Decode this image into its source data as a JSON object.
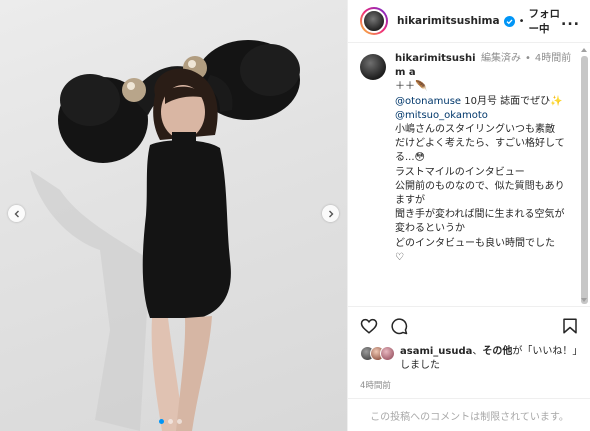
{
  "header": {
    "username": "hikarimitsushima",
    "separator": "•",
    "follow_status": "フォロー中",
    "more": "..."
  },
  "caption": {
    "username": "hikarimitsushim a",
    "edited": "編集済み",
    "dot": "•",
    "time": "4時間前",
    "lines": [
      "＋＋🪶",
      "",
      "",
      "10月号 誌面でぜひ✨",
      "",
      "",
      "小嶋さんのスタイリングいつも素敵",
      "だけどよく考えたら、すごい格好して",
      "る...😳",
      "",
      "ラストマイルのインタビュー",
      "公開前のものなので、似た質問もあり",
      "ますが",
      "聞き手が変われば間に生まれる空気が",
      "変わるというか",
      "どのインタビューも良い時間でした",
      "",
      "♡"
    ],
    "mention1": "@otonamuse",
    "mention2": "@mitsuo_okamoto"
  },
  "likes": {
    "user": "asami_usuda",
    "sep": "、",
    "others": "その他",
    "suffix": "が「いいね！」しました"
  },
  "timestamp": "4時間前",
  "comments_disabled": "この投稿へのコメントは制限されています。",
  "colors": {
    "accent": "#0095f6",
    "verified": "#0095f6",
    "mention": "#00376b",
    "muted": "#8e8e8e"
  },
  "icons": [
    "heart-icon",
    "comment-icon",
    "bookmark-icon",
    "verified-badge-icon",
    "chevron-left-icon",
    "chevron-right-icon"
  ]
}
